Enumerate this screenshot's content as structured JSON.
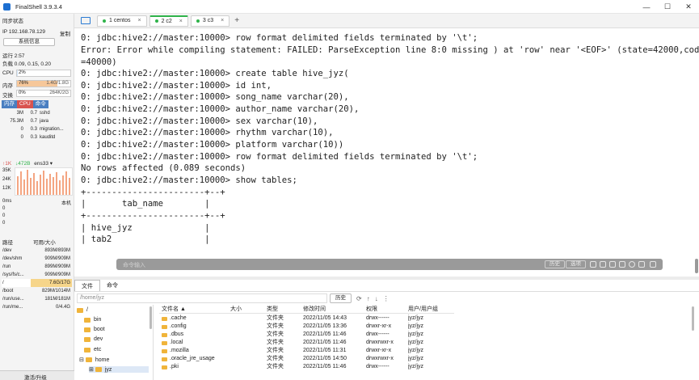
{
  "app": {
    "title": "FinalShell 3.9.3.4"
  },
  "window_controls": {
    "minimize": "—",
    "maximize": "☐",
    "close": "✕"
  },
  "sidebar": {
    "sync_label": "同步状态",
    "ip_label": "IP 192.168.78.129",
    "copy_label": "复制",
    "sysinfo_button": "系统信息",
    "uptime": "运行 2:57",
    "load": "负载 0.09, 0.15, 0.20",
    "cpu": {
      "label": "CPU",
      "value": "2%",
      "percent": 2
    },
    "mem": {
      "label": "内存",
      "value": "76%",
      "right": "1.4G/1.8G",
      "percent": 76
    },
    "swap": {
      "label": "交换",
      "value": "0%",
      "right": "264K/2G",
      "percent": 0
    },
    "proc_tabs": [
      "内存",
      "CPU",
      "命令"
    ],
    "processes": [
      {
        "mem": "3M",
        "cpu": "0.7",
        "name": "sshd"
      },
      {
        "mem": "75.3M",
        "cpu": "0.7",
        "name": "java"
      },
      {
        "mem": "0",
        "cpu": "0.3",
        "name": "migration..."
      },
      {
        "mem": "0",
        "cpu": "0.3",
        "name": "kauditd"
      }
    ],
    "net": {
      "up": "↑1K",
      "down": "↓472B",
      "iface": "ens33 ▾"
    },
    "chart_labels": [
      "35K",
      "24K",
      "12K"
    ],
    "latency": {
      "label": "0ms",
      "right": "本机",
      "values": [
        "0",
        "0",
        "0"
      ]
    },
    "disk_head": {
      "path": "路径",
      "avail": "可用/大小"
    },
    "disks": [
      {
        "path": "/dev",
        "value": "893M/893M"
      },
      {
        "path": "/dev/shm",
        "value": "909M/909M"
      },
      {
        "path": "/run",
        "value": "899M/909M"
      },
      {
        "path": "/sys/fs/c...",
        "value": "909M/909M"
      },
      {
        "path": "/",
        "value": "7.6G/17G"
      },
      {
        "path": "/boot",
        "value": "829M/1014M"
      },
      {
        "path": "/run/use...",
        "value": "181M/181M"
      },
      {
        "path": "/run/me...",
        "value": "0/4.4G"
      }
    ],
    "bottom": "激活/升级"
  },
  "tabs": [
    {
      "label": "1 centos",
      "close": "×"
    },
    {
      "label": "2 c2",
      "close": "×"
    },
    {
      "label": "3 c3",
      "close": "×"
    }
  ],
  "tab_add": "+",
  "terminal": {
    "lines": [
      "0: jdbc:hive2://master:10000> row format delimited fields terminated by '\\t';",
      "Error: Error while compiling statement: FAILED: ParseException line 8:0 missing ) at 'row' near '<EOF>' (state=42000,code",
      "=40000)",
      "0: jdbc:hive2://master:10000> create table hive_jyz(",
      "0: jdbc:hive2://master:10000> id int,",
      "0: jdbc:hive2://master:10000> song_name varchar(20),",
      "0: jdbc:hive2://master:10000> author_name varchar(20),",
      "0: jdbc:hive2://master:10000> sex varchar(10),",
      "0: jdbc:hive2://master:10000> rhythm varchar(10),",
      "0: jdbc:hive2://master:10000> platform varchar(10))",
      "0: jdbc:hive2://master:10000> row format delimited fields terminated by '\\t';",
      "No rows affected (0.089 seconds)",
      "0: jdbc:hive2://master:10000> show tables;",
      "+-----------------------+--+",
      "|       tab_name        |",
      "+-----------------------+--+",
      "| hive_jyz              |",
      "| tab2                  |"
    ],
    "command_placeholder": "命令输入",
    "history_button": "历史",
    "options_button": "选项"
  },
  "filemanager": {
    "tabs": [
      "文件",
      "命令"
    ],
    "path": "/home/jyz",
    "history_button": "历史",
    "tree": [
      {
        "label": "/"
      },
      {
        "label": "bin"
      },
      {
        "label": "boot"
      },
      {
        "label": "dev"
      },
      {
        "label": "etc"
      },
      {
        "label": "home"
      },
      {
        "label": "jyz"
      }
    ],
    "columns": [
      "文件名 ▲",
      "大小",
      "类型",
      "修改时间",
      "权限",
      "用户/用户组"
    ],
    "files": [
      {
        "name": ".cache",
        "size": "",
        "type": "文件夹",
        "modified": "2022/11/05 14:43",
        "perm": "drwx------",
        "owner": "jyz/jyz"
      },
      {
        "name": ".config",
        "size": "",
        "type": "文件夹",
        "modified": "2022/11/05 13:36",
        "perm": "drwxr-xr-x",
        "owner": "jyz/jyz"
      },
      {
        "name": ".dbus",
        "size": "",
        "type": "文件夹",
        "modified": "2022/11/05 11:46",
        "perm": "drwx------",
        "owner": "jyz/jyz"
      },
      {
        "name": ".local",
        "size": "",
        "type": "文件夹",
        "modified": "2022/11/05 11:46",
        "perm": "drwxrwxr-x",
        "owner": "jyz/jyz"
      },
      {
        "name": ".mozilla",
        "size": "",
        "type": "文件夹",
        "modified": "2022/11/05 11:31",
        "perm": "drwxr-xr-x",
        "owner": "jyz/jyz"
      },
      {
        "name": ".oracle_jre_usage",
        "size": "",
        "type": "文件夹",
        "modified": "2022/11/05 14:50",
        "perm": "drwxrwxr-x",
        "owner": "jyz/jyz"
      },
      {
        "name": ".pki",
        "size": "",
        "type": "文件夹",
        "modified": "2022/11/05 11:46",
        "perm": "drwx------",
        "owner": "jyz/jyz"
      }
    ]
  },
  "colors": {
    "accent_blue": "#2a7bd3",
    "tab_active": "#2fb34a",
    "mem_fill": "#f6c79a",
    "cpu_tab": "#d9534f",
    "chart_bar": "#f4a582"
  }
}
